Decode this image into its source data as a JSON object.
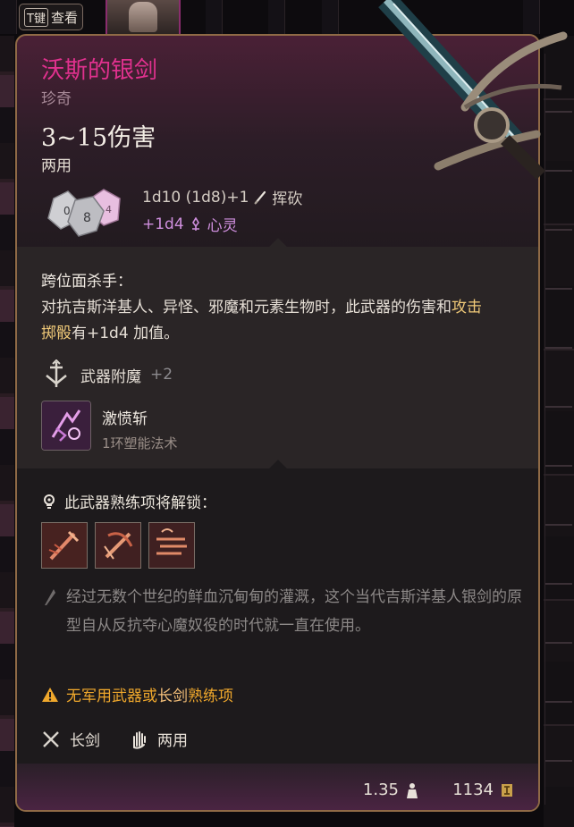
{
  "topbar": {
    "t_key_badge": "T键",
    "t_key_label": "查看"
  },
  "item": {
    "name": "沃斯的银剑",
    "rarity": "珍奇",
    "damage": "3~15伤害",
    "handedness": "两用",
    "damage_line1": "1d10 (1d8)+1",
    "damage_type1": "挥砍",
    "damage_line2": "+1d4",
    "damage_type2": "心灵",
    "dice_numbers": [
      "0",
      "8",
      "4"
    ]
  },
  "ability": {
    "name": "跨位面杀手：",
    "desc_part1": "对抗吉斯洋基人、异怪、邪魔和元素生物时，此武器的伤害和",
    "desc_highlight": "攻击掷骰",
    "desc_part2": "有+1d4 加值。"
  },
  "enchant": {
    "label": "武器附魔",
    "bonus": "+2"
  },
  "spell": {
    "name": "激愤斩",
    "type": "1环塑能法术"
  },
  "unlock": {
    "title": "此武器熟练项将解锁："
  },
  "lore": "经过无数个世纪的鲜血沉甸甸的灌溉，这个当代吉斯洋基人银剑的原型自从反抗夺心魔奴役的时代就一直在使用。",
  "warning": {
    "part1": "无军用武器或",
    "highlight": "长剑",
    "part2": "熟练项"
  },
  "properties": {
    "type": "长剑",
    "handed": "两用"
  },
  "footer": {
    "weight": "1.35",
    "price": "1134"
  },
  "colors": {
    "rarity_title": "#e0318e",
    "psychic": "#cf8fde",
    "warning": "#f0a82c",
    "border": "#8f6a46"
  }
}
